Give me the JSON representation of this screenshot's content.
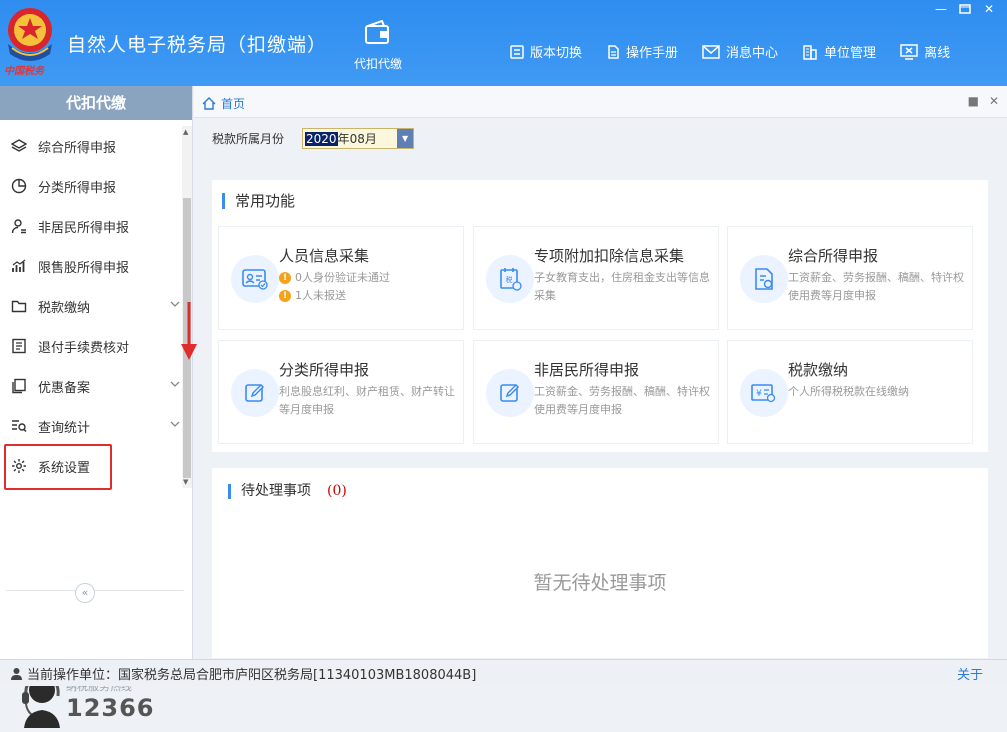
{
  "header": {
    "title": "自然人电子税务局（扣缴端）",
    "logo_caption": "中国税务",
    "nav_main": "代扣代缴",
    "menu": [
      {
        "label": "版本切换",
        "icon": "switch-icon"
      },
      {
        "label": "操作手册",
        "icon": "manual-icon"
      },
      {
        "label": "消息中心",
        "icon": "mail-icon"
      },
      {
        "label": "单位管理",
        "icon": "building-icon"
      },
      {
        "label": "离线",
        "icon": "offline-icon"
      }
    ]
  },
  "sidebar": {
    "title": "代扣代缴",
    "items": [
      {
        "label": "综合所得申报",
        "icon": "layers-icon"
      },
      {
        "label": "分类所得申报",
        "icon": "pie-icon"
      },
      {
        "label": "非居民所得申报",
        "icon": "person-icon"
      },
      {
        "label": "限售股所得申报",
        "icon": "bar-chart-icon"
      },
      {
        "label": "税款缴纳",
        "icon": "folder-icon"
      },
      {
        "label": "退付手续费核对",
        "icon": "list-icon"
      },
      {
        "label": "优惠备案",
        "icon": "copy-icon"
      },
      {
        "label": "查询统计",
        "icon": "search-list-icon"
      },
      {
        "label": "系统设置",
        "icon": "gear-icon"
      }
    ],
    "hotline_label": "纳税服务热线",
    "hotline_number": "12366"
  },
  "tab": {
    "home": "首页"
  },
  "period": {
    "label": "税款所属月份",
    "year": "2020",
    "rest": "年08月"
  },
  "common": {
    "title": "常用功能",
    "cards": [
      {
        "title": "人员信息采集",
        "warn1": "0人身份验证未通过",
        "warn2": "1人未报送"
      },
      {
        "title": "专项附加扣除信息采集",
        "desc": "子女教育支出，住房租金支出等信息采集"
      },
      {
        "title": "综合所得申报",
        "desc": "工资薪金、劳务报酬、稿酬、特许权使用费等月度申报"
      },
      {
        "title": "分类所得申报",
        "desc": "利息股息红利、财产租赁、财产转让等月度申报"
      },
      {
        "title": "非居民所得申报",
        "desc": "工资薪金、劳务报酬、稿酬、特许权使用费等月度申报"
      },
      {
        "title": "税款缴纳",
        "desc": "个人所得税税款在线缴纳"
      }
    ]
  },
  "pending": {
    "title": "待处理事项",
    "count": "(0)",
    "empty": "暂无待处理事项"
  },
  "status": {
    "unit": "当前操作单位：国家税务总局合肥市庐阳区税务局[11340103MB1808044B]",
    "about": "关于"
  },
  "colors": {
    "header": "#2f8df0",
    "accent": "#3a8bf2",
    "highlight_box": "#e12c2c"
  }
}
